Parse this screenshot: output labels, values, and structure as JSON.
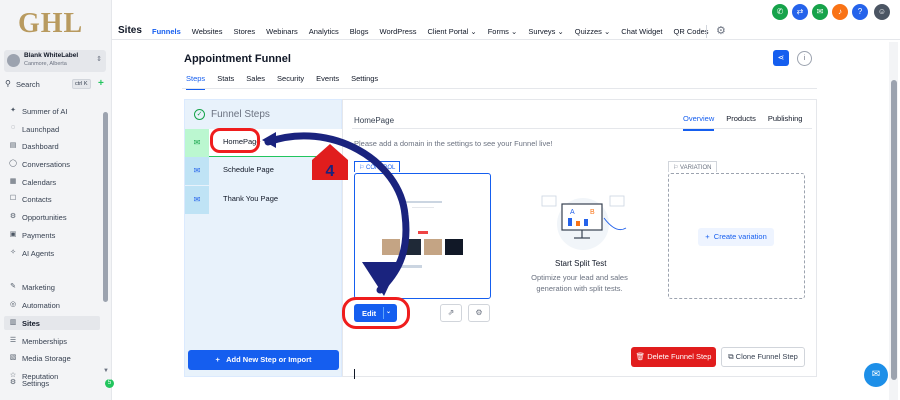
{
  "brand": {
    "logo_text": "GHL",
    "accent": "#155eef",
    "danger": "#e11d1d",
    "success": "#16a34a"
  },
  "account": {
    "name": "Blank WhiteLabel",
    "location": "Canmore, Alberta"
  },
  "search": {
    "label": "Search",
    "shortcut": "ctrl K"
  },
  "sidebar": {
    "items": [
      {
        "label": "Summer of AI",
        "icon": "sparkle-icon"
      },
      {
        "label": "Launchpad",
        "icon": "rocket-icon"
      },
      {
        "label": "Dashboard",
        "icon": "dashboard-icon"
      },
      {
        "label": "Conversations",
        "icon": "chat-icon"
      },
      {
        "label": "Calendars",
        "icon": "calendar-icon"
      },
      {
        "label": "Contacts",
        "icon": "contacts-icon"
      },
      {
        "label": "Opportunities",
        "icon": "opportunities-icon"
      },
      {
        "label": "Payments",
        "icon": "payments-icon"
      },
      {
        "label": "AI Agents",
        "icon": "ai-agents-icon"
      },
      {
        "label": "Marketing",
        "icon": "marketing-icon"
      },
      {
        "label": "Automation",
        "icon": "automation-icon"
      },
      {
        "label": "Sites",
        "icon": "sites-icon",
        "active": true
      },
      {
        "label": "Memberships",
        "icon": "memberships-icon"
      },
      {
        "label": "Media Storage",
        "icon": "media-icon"
      },
      {
        "label": "Reputation",
        "icon": "reputation-icon"
      },
      {
        "label": "Settings",
        "icon": "settings-icon"
      }
    ],
    "badge": "5"
  },
  "topbar": {
    "section": "Sites",
    "menu": [
      "Funnels",
      "Websites",
      "Stores",
      "Webinars",
      "Analytics",
      "Blogs",
      "WordPress",
      "Client Portal ⌄",
      "Forms ⌄",
      "Surveys ⌄",
      "Quizzes ⌄",
      "Chat Widget",
      "QR Codes"
    ],
    "active_menu": "Funnels"
  },
  "funnel": {
    "title": "Appointment Funnel",
    "tabs": [
      "Steps",
      "Stats",
      "Sales",
      "Security",
      "Events",
      "Settings"
    ],
    "active_tab": "Steps"
  },
  "steps_panel": {
    "title": "Funnel Steps",
    "steps": [
      "HomePage",
      "Schedule Page",
      "Thank You Page"
    ],
    "add_button": "Add New Step or Import"
  },
  "detail": {
    "page_name": "HomePage",
    "tabs": [
      "Overview",
      "Products",
      "Publishing"
    ],
    "active_tab": "Overview",
    "domain_note": "Please add a domain in the settings to see your Funnel live!",
    "control_tag": "CONTROL",
    "variation_tag": "VARIATION",
    "edit_label": "Edit",
    "split_title": "Start Split Test",
    "split_desc": "Optimize your lead and sales generation with split tests.",
    "create_variation": "Create variation",
    "delete_label": "Delete Funnel Step",
    "clone_label": "Clone Funnel Step",
    "illus_a": "A",
    "illus_b": "B"
  },
  "annotation": {
    "step_number": "4",
    "color": "#ef1d1d",
    "arrow_color": "#1a237e"
  }
}
